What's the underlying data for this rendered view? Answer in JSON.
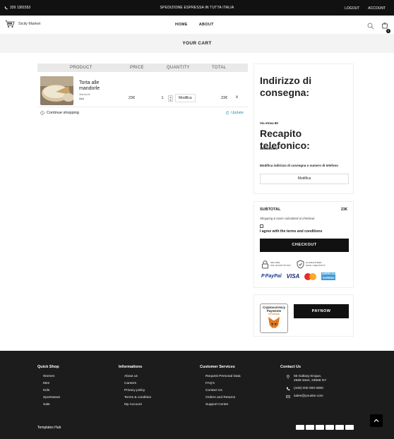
{
  "topbar": {
    "phone": "329 1381553",
    "promo": "SPEDIZIONE ESPRESSA IN TUTTA ITALIA",
    "logout": "LOGOUT",
    "account": "ACCOUNT"
  },
  "header": {
    "brand": "Sicily Market",
    "nav": [
      "HOME",
      "ABOUT"
    ],
    "cart_count": "0",
    "icons": [
      "search-icon",
      "shopping-bag-icon"
    ]
  },
  "page": {
    "title": "YOUR CART"
  },
  "cart": {
    "columns": [
      "PRODUCT",
      "PRICE",
      "QUANTITY",
      "TOTAL"
    ],
    "items": [
      {
        "name": "Torta alle mandorle",
        "variant": "Mandorle",
        "sub": "Apri",
        "price": "23€",
        "quantity": "1",
        "edit_label": "Modifica",
        "total": "23€",
        "remove": "x"
      }
    ],
    "continue_label": "Continue shopping",
    "update_label": "Update"
  },
  "delivery": {
    "address_heading": "Indirizzo di consegna:",
    "address_value": "Via etnea 80",
    "phone_heading": "Recapito telefonico:",
    "phone_value": "3291381553",
    "note": "Modifica indirizzo di consegna o numero di telefono",
    "edit_label": "Modifica"
  },
  "summary": {
    "subtotal_label": "SUBTOTAL",
    "subtotal_value": "23€",
    "shipping_note": "Shopping & taxes calculated at checkout",
    "terms_checked": false,
    "terms_label": "I agree with the terms and conditions",
    "checkout_label": "CHECKOUT",
    "secure_badge": [
      "SECURE",
      "SSL ENCRYPTION"
    ],
    "guarantee_badge": [
      "GUARANTEED",
      "SAFE CHECKOUT"
    ],
    "paypal_label": "PayPal",
    "visa_label": "VISA",
    "amex_label": "AMERICAN EXPRESS"
  },
  "crypto": {
    "card_title": "Cryptocurrency Payments",
    "card_sub": "MetaMask",
    "paynow_label": "PAYNOW"
  },
  "footer": {
    "quick_shop": {
      "title": "Quick Shop",
      "links": [
        "Women",
        "Men",
        "Kids",
        "Sportswear",
        "Sale"
      ]
    },
    "informations": {
      "title": "Informations",
      "links": [
        "About us",
        "Careers",
        "Privacy policy",
        "Terms & condition",
        "My Account"
      ]
    },
    "customer_services": {
      "title": "Customer Services",
      "links": [
        "Request Personal Data",
        "FAQ's",
        "Contact Us",
        "Orders and Returns",
        "Support Center"
      ]
    },
    "contact": {
      "title": "Contact Us",
      "address_line1": "55 Gallaxy Enque,",
      "address_line2": "2568 steet, 23568 NY",
      "phone": "(440) 000 000 0000",
      "email": "sales@yousite.com"
    },
    "copyright": "Templates Hub"
  },
  "colors": {
    "accent": "#1a9db0",
    "dark": "#111111",
    "footer_bg": "#1c1c1c"
  }
}
